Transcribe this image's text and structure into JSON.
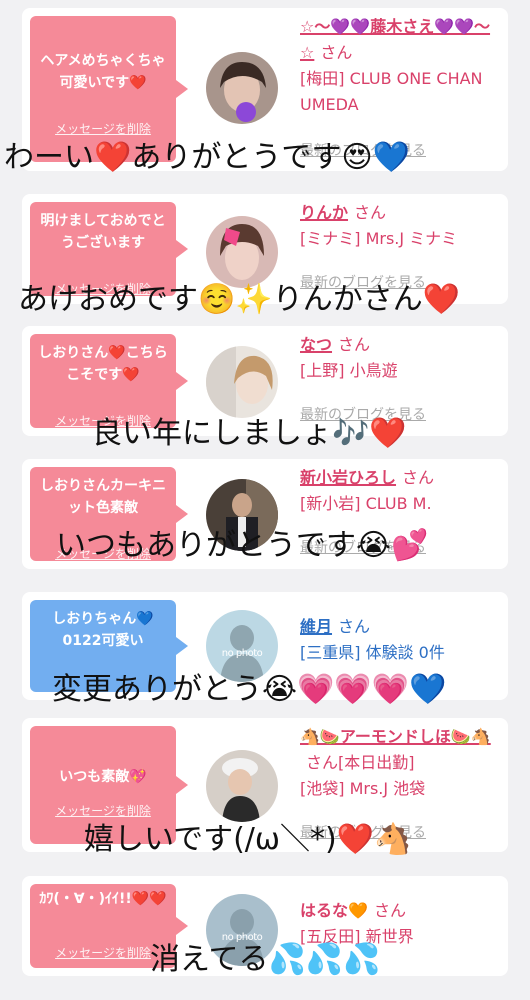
{
  "cards": [
    {
      "message": "ヘアメめちゃくちゃ可愛いです❤️",
      "delete_label": "メッセージを削除",
      "name": "☆〜💜💜藤木さえ💜💜〜☆",
      "honorific": "さん",
      "shop": "[梅田] CLUB ONE CHAN UMEDA",
      "blog_link": "最新のブログを見る",
      "bubble_color": "#f58a98",
      "overlay": "わーい❤️ありがとうです😍💙"
    },
    {
      "message": "明けましておめでとうございます",
      "delete_label": "メッセージを削除",
      "name": "りんか",
      "honorific": "さん",
      "shop": "[ミナミ] Mrs.J ミナミ",
      "blog_link": "最新のブログを見る",
      "bubble_color": "#f58a98",
      "overlay": "あけおめです☺️✨りんかさん❤️"
    },
    {
      "message": "しおりさん❤️こちらこそです❤️",
      "delete_label": "メッセージを削除",
      "name": "なつ",
      "honorific": "さん",
      "shop": "[上野] 小鳥遊",
      "blog_link": "最新のブログを見る",
      "bubble_color": "#f58a98",
      "overlay": "良い年にしましょ🎶❤️"
    },
    {
      "message": "しおりさんカーキニット色素敵",
      "delete_label": "メッセージを削除",
      "name": "新小岩ひろし",
      "honorific": "さん",
      "shop": "[新小岩] CLUB M.",
      "blog_link": "最新のブログを見る",
      "bubble_color": "#f58a98",
      "overlay": "いつもありがとうです😭💕"
    },
    {
      "message": "しおりちゃん💙0122可愛い",
      "delete_label": "メッセージを削除",
      "name": "維月",
      "honorific": "さん",
      "shop": "[三重県] 体験談 0件",
      "photo_text": "no photo",
      "bubble_color": "#72aef0",
      "overlay": "変更ありがとう😭💗💗💗💙"
    },
    {
      "message": "いつも素敵💖",
      "delete_label": "メッセージを削除",
      "name": "🐴🍉アーモンドしほ🍉🐴",
      "honorific": "さん[本日出勤]",
      "shop": "[池袋] Mrs.J 池袋",
      "blog_link": "最新のブログを見る",
      "bubble_color": "#f58a98",
      "overlay": "嬉しいです(/ω＼*)❤️🐴"
    },
    {
      "message": "ｶﾜ(・∀・)ｲｲ!!❤️❤️",
      "delete_label": "メッセージを削除",
      "name": "はるな🧡",
      "honorific": "さん",
      "shop": "[五反田] 新世界",
      "photo_text": "no photo",
      "bubble_color": "#f58a98",
      "overlay": "消えてる💦💦💦"
    }
  ]
}
